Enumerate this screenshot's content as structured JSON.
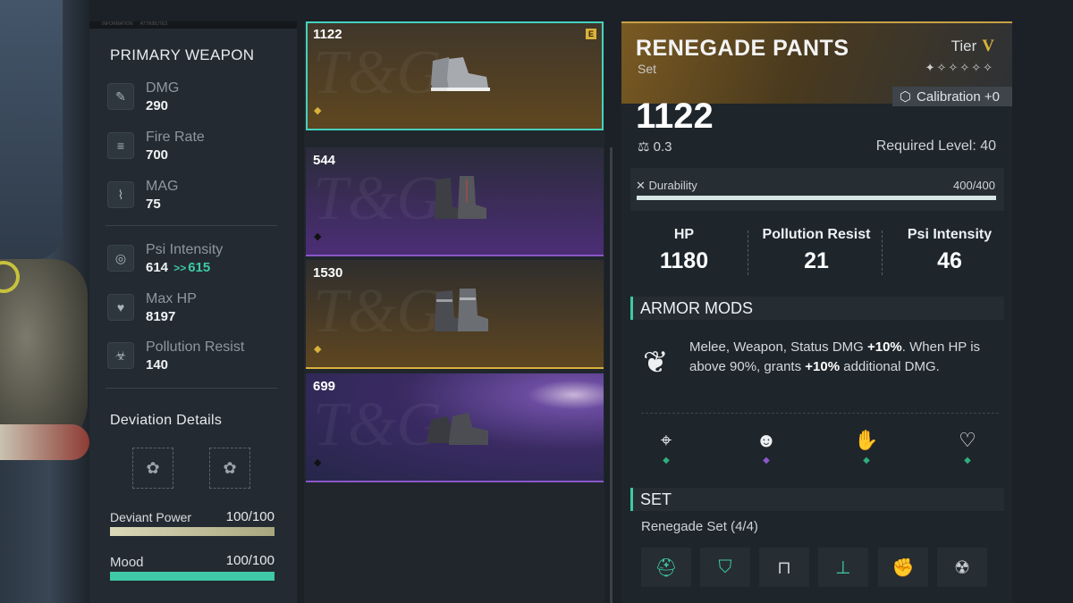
{
  "stats_panel": {
    "tab_labels": [
      "INFORMATION",
      "ATTRIBUTES"
    ],
    "primary_title": "PRIMARY WEAPON",
    "weapon_stats": [
      {
        "name": "DMG",
        "value": "290",
        "icon": "damage-icon"
      },
      {
        "name": "Fire Rate",
        "value": "700",
        "icon": "fire-rate-icon"
      },
      {
        "name": "MAG",
        "value": "75",
        "icon": "magazine-icon"
      }
    ],
    "player_stats": [
      {
        "name": "Psi Intensity",
        "value": "614",
        "arrow": ">>",
        "new_value": "615",
        "icon": "psi-icon"
      },
      {
        "name": "Max HP",
        "value": "8197",
        "icon": "heart-icon"
      },
      {
        "name": "Pollution Resist",
        "value": "140",
        "icon": "biohazard-icon"
      }
    ],
    "deviation_title": "Deviation Details",
    "deviant_power": {
      "label": "Deviant Power",
      "value": "100/100",
      "fraction": 1.0
    },
    "mood": {
      "label": "Mood",
      "value": "100/100",
      "fraction": 1.0
    }
  },
  "item_list": [
    {
      "score": "1122",
      "rarity": "legendary",
      "badge": "E",
      "selected": true
    },
    {
      "score": "544",
      "rarity": "epic",
      "selected": false
    },
    {
      "score": "1530",
      "rarity": "legendary",
      "selected": false
    },
    {
      "score": "699",
      "rarity": "epic",
      "selected": false
    }
  ],
  "detail": {
    "name": "RENEGADE PANTS",
    "type": "Set",
    "tier_label": "Tier",
    "tier_value": "V",
    "stars": "✦✧✧✧✧✧",
    "calibration": "Calibration +0",
    "power": "1122",
    "weight": "0.3",
    "required_level": "Required Level: 40",
    "durability_label": "Durability",
    "durability_value": "400/400",
    "durability_fraction": 1.0,
    "attributes": [
      {
        "name": "HP",
        "value": "1180"
      },
      {
        "name": "Pollution Resist",
        "value": "21"
      },
      {
        "name": "Psi Intensity",
        "value": "46"
      }
    ],
    "armor_mods_title": "ARMOR MODS",
    "mod_text_1": "Melee, Weapon, Status DMG ",
    "mod_bold_1": "+10%",
    "mod_text_2": ". When HP is above 90%, grants ",
    "mod_bold_2": "+10%",
    "mod_text_3": " additional DMG.",
    "mod_slots": [
      {
        "icon": "crosshair-icon",
        "color": "#2fae7f"
      },
      {
        "icon": "head-star-icon",
        "color": "#8b57c9"
      },
      {
        "icon": "hand-icon",
        "color": "#2fae7f"
      },
      {
        "icon": "heart-pulse-icon",
        "color": "#2fae7f"
      }
    ],
    "set_title": "SET",
    "set_name": "Renegade Set (4/4)",
    "set_pieces": [
      {
        "icon": "helmet-icon",
        "active": true
      },
      {
        "icon": "top-icon",
        "active": true
      },
      {
        "icon": "pants-icon",
        "active": false
      },
      {
        "icon": "boots-icon",
        "active": true
      },
      {
        "icon": "gloves-icon",
        "active": true
      },
      {
        "icon": "mask-icon",
        "active": false
      }
    ]
  },
  "colors": {
    "accent": "#3ec9a4",
    "legendary": "#d9b23c",
    "epic": "#8b57c9"
  }
}
